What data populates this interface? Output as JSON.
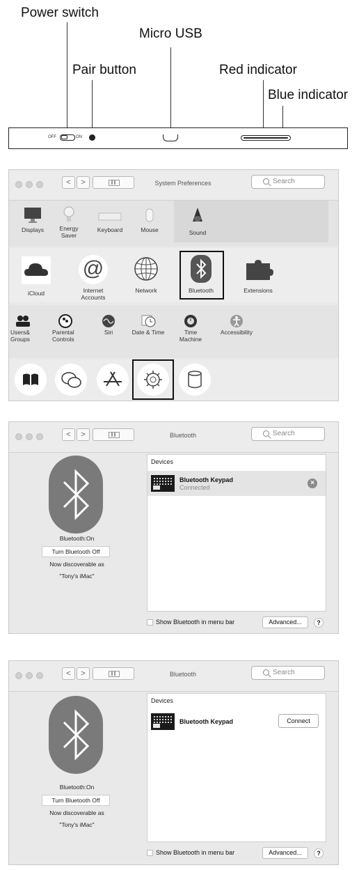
{
  "diagram": {
    "callouts": {
      "power_switch": "Power switch",
      "micro_usb": "Micro USB",
      "pair_button": "Pair button",
      "red_indicator": "Red indicator",
      "blue_indicator": "Blue indicator"
    },
    "switch_off": "OFF",
    "switch_on": "ON"
  },
  "prefs_window": {
    "title": "System Preferences",
    "search_placeholder": "Search",
    "row1": [
      "Displays",
      "Energy Saver",
      "Keyboard",
      "Mouse",
      "Sound"
    ],
    "row2": [
      "iCloud",
      "Internet Accounts",
      "Network",
      "Bluetooth",
      "Extensions"
    ],
    "row3": [
      "Users& Groups",
      "Parental Controls",
      "Siri",
      "Date & Time",
      "Time Machine",
      "Accessibility"
    ]
  },
  "bt_window_connected": {
    "title": "Bluetooth",
    "search_placeholder": "Search",
    "status": "Bluetooth:On",
    "turn_off": "Turn Bluetooth Off",
    "discoverable": "Now discoverable as",
    "mac_name": "\"Tony's iMac\"",
    "devices_label": "Devices",
    "device_name": "Bluetooth Keypad",
    "device_status": "Connected",
    "show_in_menu": "Show Bluetooth in menu bar",
    "advanced": "Advanced...",
    "help": "?"
  },
  "bt_window_connect": {
    "title": "Bluetooth",
    "search_placeholder": "Search",
    "status": "Bluetooth:On",
    "turn_off": "Turn Bluetooth Off",
    "discoverable": "Now discoverable as",
    "mac_name": "\"Tony's iMac\"",
    "devices_label": "Devices",
    "device_name": "Bluetooth Keypad",
    "connect": "Connect",
    "show_in_menu": "Show Bluetooth in menu bar",
    "advanced": "Advanced...",
    "help": "?"
  }
}
